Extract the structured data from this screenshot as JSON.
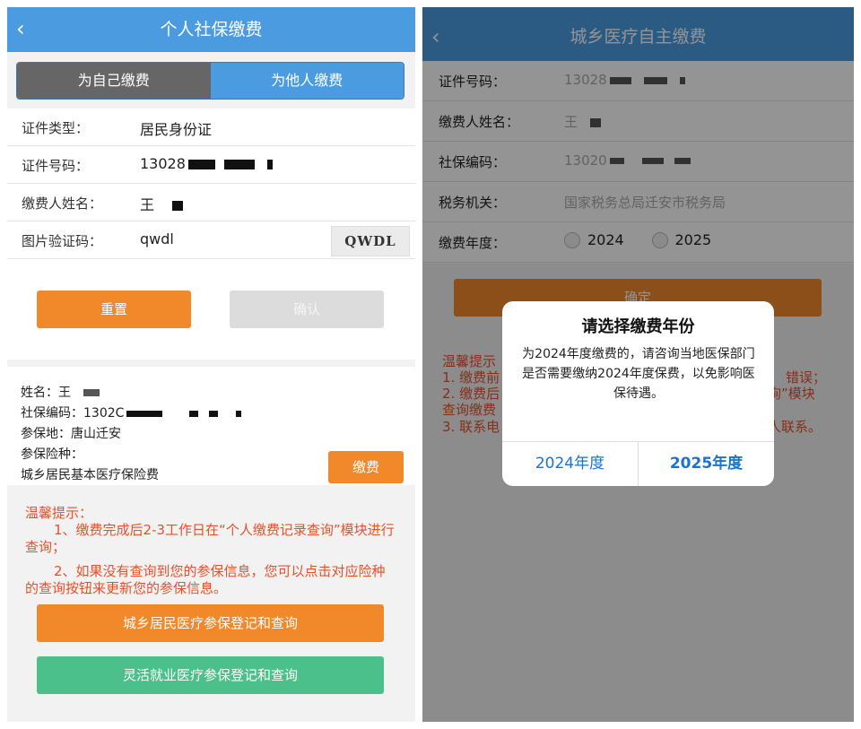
{
  "left": {
    "nav": {
      "back_icon": "‹",
      "title": "个人社保缴费"
    },
    "tabs": [
      {
        "label": "为自己缴费",
        "active": true
      },
      {
        "label": "为他人缴费",
        "active": false
      }
    ],
    "form": {
      "id_type": {
        "label": "证件类型：",
        "value": "居民身份证"
      },
      "id_number": {
        "label": "证件号码：",
        "value": "13028"
      },
      "payer_name": {
        "label": "缴费人姓名：",
        "value": "王"
      },
      "captcha": {
        "label": "图片验证码：",
        "value": "qwdl",
        "image_text": "QWDL"
      }
    },
    "buttons": {
      "reset": "重置",
      "confirm": "确认"
    },
    "insured": {
      "name": "姓名：王",
      "ss_code": "社保编码：1302C",
      "place": "参保地：唐山迁安",
      "type_label": "参保险种：",
      "type_value": "城乡居民基本医疗保险费",
      "pay_button": "缴费"
    },
    "tips": {
      "title": "温馨提示：",
      "line1": "1、缴费完成后2-3工作日在“个人缴费记录查询”模块进行查询；",
      "line2": "2、如果没有查询到您的参保信息，您可以点击对应险种的查询按钮来更新您的参保信息。",
      "button_urban": "城乡居民医疗参保登记和查询",
      "button_flexible": "灵活就业医疗参保登记和查询"
    }
  },
  "right": {
    "nav": {
      "back_icon": "‹",
      "title": "城乡医疗自主缴费"
    },
    "rows": {
      "id_number": {
        "label": "证件号码：",
        "value": "13028"
      },
      "payer_name": {
        "label": "缴费人姓名：",
        "value": "王"
      },
      "ss_code": {
        "label": "社保编码：",
        "value": "13020"
      },
      "tax_office": {
        "label": "税务机关：",
        "value": "国家税务总局迁安市税务局"
      },
      "year": {
        "label": "缴费年度：",
        "options": [
          "2024",
          "2025"
        ]
      }
    },
    "confirm_button": "确定",
    "tips_visible": {
      "title": "温馨提示",
      "l1a": "1. 缴费前",
      "l1b": "错误；",
      "l2a": "2. 缴费后",
      "l2b": "询”模块",
      "l3": "查询缴费",
      "l4a": "3. 联系电",
      "l4b": "人联系。"
    },
    "dialog": {
      "title": "请选择缴费年份",
      "message": "为2024年度缴费的，请咨询当地医保部门是否需要缴纳2024年度保费，以免影响医保待遇。",
      "btn_2024": "2024年度",
      "btn_2025": "2025年度"
    }
  }
}
